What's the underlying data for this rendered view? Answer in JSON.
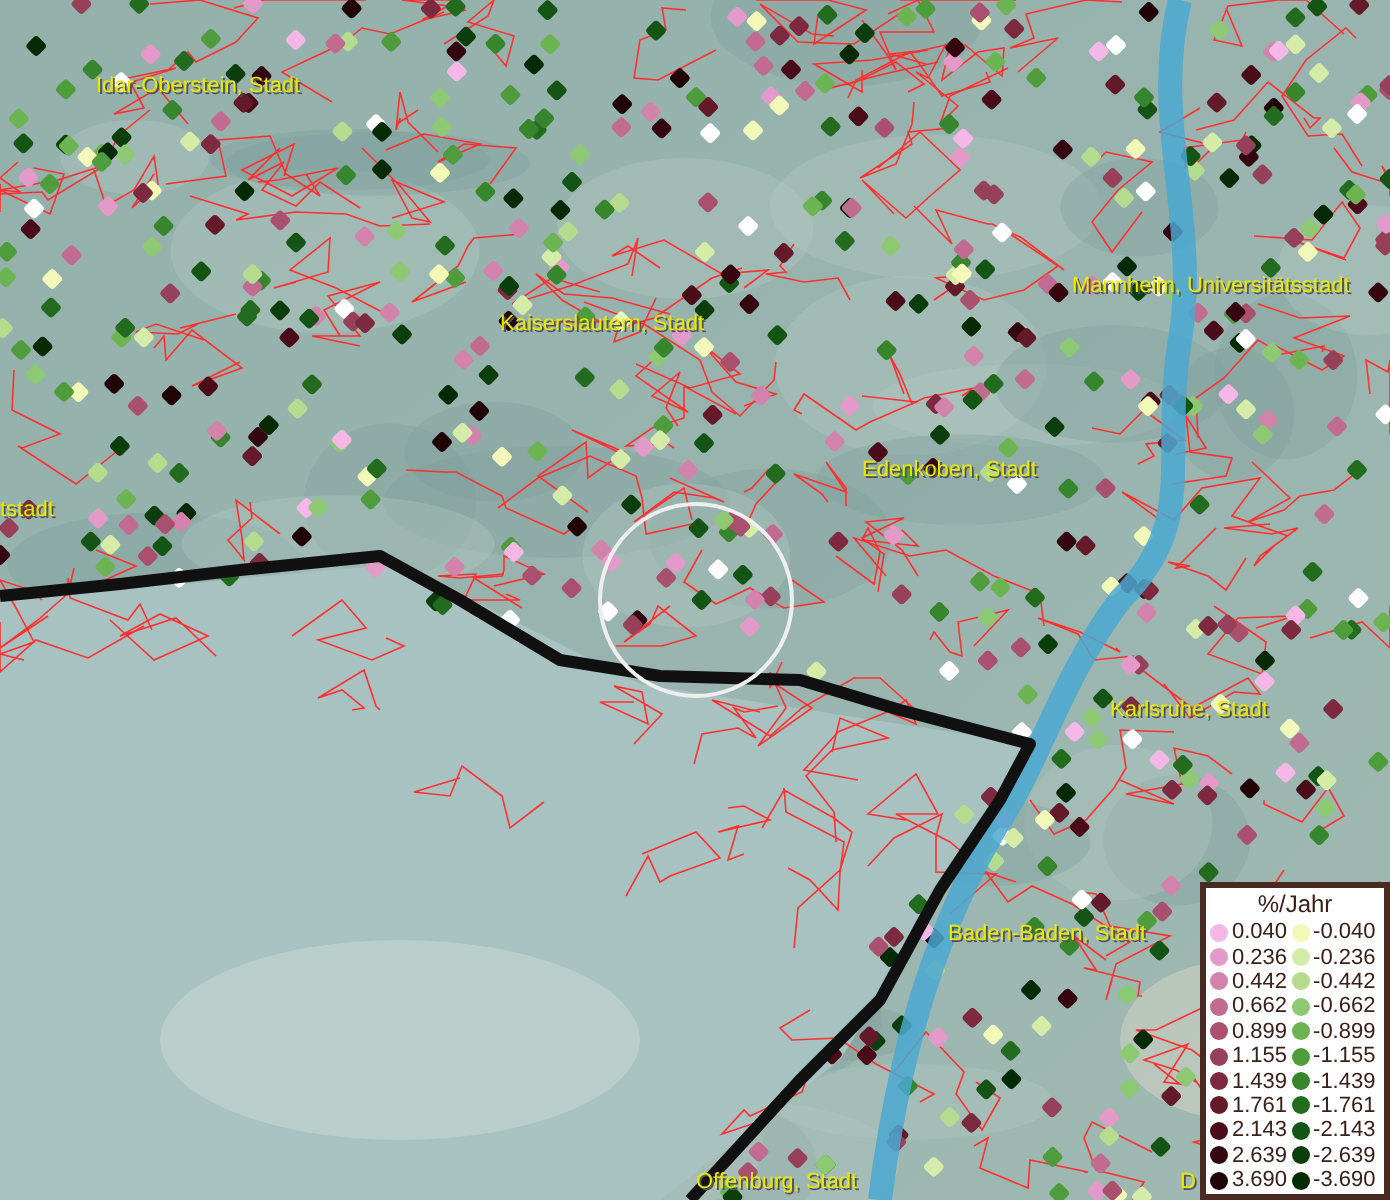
{
  "map": {
    "place_labels": [
      "Idar-Oberstein, Stadt",
      "Kaiserslautern, Stadt",
      "Mannheim, Universitätsstadt",
      "Edenkoben, Stadt",
      "tstadt",
      "Karlsruhe, Stadt",
      "Baden-Baden, Stadt",
      "Offenburg, Stadt",
      "D"
    ]
  },
  "legend": {
    "title": "%/Jahr",
    "positive": [
      {
        "value": "0.040",
        "color": "#f5b8e6"
      },
      {
        "value": "0.236",
        "color": "#e49ac8"
      },
      {
        "value": "0.442",
        "color": "#d283ab"
      },
      {
        "value": "0.662",
        "color": "#c06b8f"
      },
      {
        "value": "0.899",
        "color": "#a9506f"
      },
      {
        "value": "1.155",
        "color": "#96405a"
      },
      {
        "value": "1.439",
        "color": "#7d2a40"
      },
      {
        "value": "1.761",
        "color": "#651a2a"
      },
      {
        "value": "2.143",
        "color": "#4a0c18"
      },
      {
        "value": "2.639",
        "color": "#330610"
      },
      {
        "value": "3.690",
        "color": "#200307"
      }
    ],
    "negative": [
      {
        "value": "-0.040",
        "color": "#f2f8b8"
      },
      {
        "value": "-0.236",
        "color": "#d5eca8"
      },
      {
        "value": "-0.442",
        "color": "#b5dc8e"
      },
      {
        "value": "-0.662",
        "color": "#8dc872"
      },
      {
        "value": "-0.899",
        "color": "#6cb452"
      },
      {
        "value": "-1.155",
        "color": "#4e9c3c"
      },
      {
        "value": "-1.439",
        "color": "#37852c"
      },
      {
        "value": "-1.761",
        "color": "#236c1f"
      },
      {
        "value": "-2.143",
        "color": "#145414"
      },
      {
        "value": "-2.639",
        "color": "#0b3e0c"
      },
      {
        "value": "-3.690",
        "color": "#062a06"
      }
    ]
  }
}
